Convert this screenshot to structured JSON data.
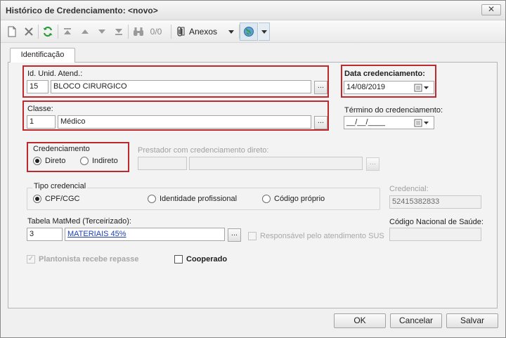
{
  "window": {
    "title": "Histórico de Credenciamento: <novo>",
    "close_glyph": "✕"
  },
  "toolbar": {
    "record_counter": "0/0",
    "attachments_label": "Anexos",
    "icons": [
      "new-doc-icon",
      "delete-icon",
      "refresh-icon",
      "first-record-icon",
      "previous-record-icon",
      "next-record-icon",
      "last-record-icon",
      "binoculars-icon",
      "paperclip-icon",
      "dropdown-arrow-icon",
      "globe-icon",
      "dropdown-arrow-icon"
    ]
  },
  "tabs": [
    {
      "label": "Identificação",
      "active": true
    }
  ],
  "form": {
    "unit": {
      "label": "Id. Unid. Atend.:",
      "code": "15",
      "name": "BLOCO CIRURGICO",
      "button": "..."
    },
    "class": {
      "label": "Classe:",
      "code": "1",
      "name": "Médico",
      "button": "..."
    },
    "date_start": {
      "label": "Data credenciamento:",
      "value": "14/08/2019"
    },
    "date_end": {
      "label": "Término do credenciamento:",
      "value": "__/__/____"
    },
    "credenciamento": {
      "label": "Credenciamento",
      "options": [
        {
          "label": "Direto",
          "selected": true
        },
        {
          "label": "Indireto",
          "selected": false
        }
      ]
    },
    "direct_provider": {
      "label": "Prestador com credenciamento direto:",
      "code": "",
      "name": "",
      "button": "..."
    },
    "credential_type": {
      "label": "Tipo credencial",
      "options": [
        {
          "label": "CPF/CGC",
          "selected": true
        },
        {
          "label": "Identidade profissional",
          "selected": false
        },
        {
          "label": "Código próprio",
          "selected": false
        }
      ]
    },
    "credential": {
      "label": "Credencial:",
      "value": "52415382833"
    },
    "matmed": {
      "label": "Tabela MatMed (Terceirizado):",
      "code": "3",
      "name": "MATERIAIS 45%",
      "button": "..."
    },
    "sus_responsible": {
      "label": "Responsável pelo atendimento SUS",
      "checked": false
    },
    "cns": {
      "label": "Código Nacional de Saúde:",
      "value": ""
    },
    "plantonista": {
      "label": "Plantonista recebe repasse",
      "checked": true
    },
    "cooperado": {
      "label": "Cooperado",
      "checked": false
    }
  },
  "footer": {
    "ok": "OK",
    "cancel": "Cancelar",
    "save": "Salvar"
  },
  "colors": {
    "highlight": "#c0282e",
    "link": "#1b3fb0"
  }
}
